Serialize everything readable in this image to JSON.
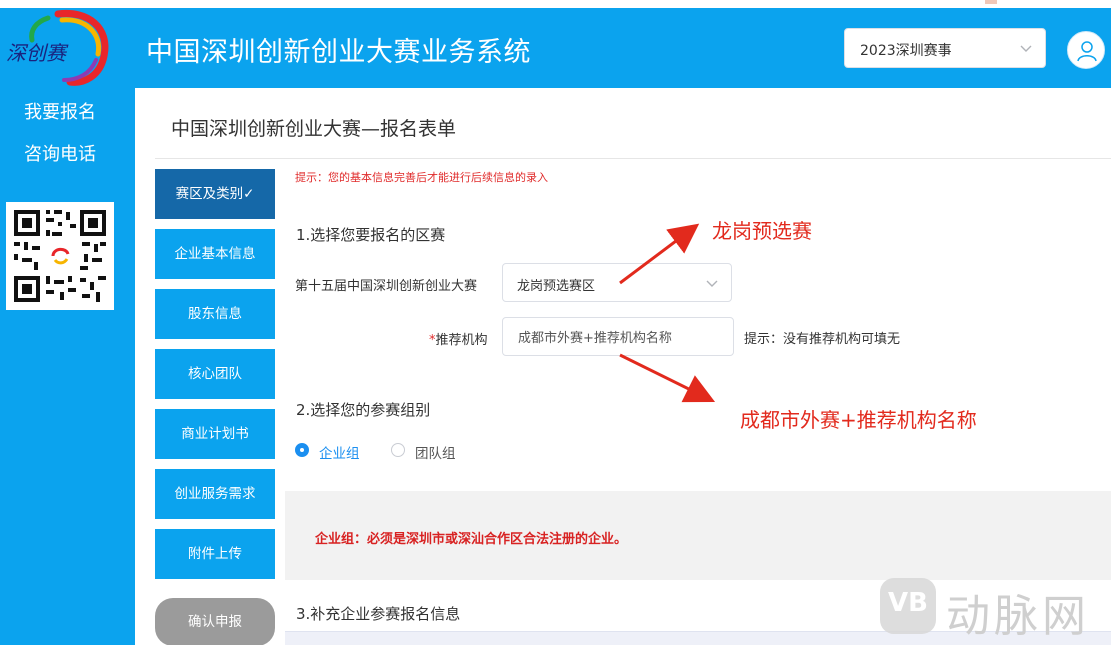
{
  "header": {
    "logo_text": "深创赛",
    "title": "中国深圳创新创业大赛业务系统",
    "year_select": "2023深圳赛事"
  },
  "left_nav": {
    "items": [
      {
        "label": "我要报名"
      },
      {
        "label": "咨询电话"
      }
    ]
  },
  "form": {
    "title": "中国深圳创新创业大赛—报名表单",
    "tip": "提示：您的基本信息完善后才能进行后续信息的录入",
    "steps": [
      {
        "label": "赛区及类别✓",
        "active": true
      },
      {
        "label": "企业基本信息"
      },
      {
        "label": "股东信息"
      },
      {
        "label": "核心团队"
      },
      {
        "label": "商业计划书"
      },
      {
        "label": "创业服务需求"
      },
      {
        "label": "附件上传"
      },
      {
        "label": "确认申报"
      }
    ],
    "section1_title": "1.选择您要报名的区赛",
    "competition_label": "第十五届中国深圳创新创业大赛",
    "region_value": "龙岗预选赛区",
    "recommender_label": "推荐机构",
    "recommender_required_mark": "*",
    "recommender_value": "成都市外赛+推荐机构名称",
    "recommender_hint": "提示：没有推荐机构可填无",
    "section2_title": "2.选择您的参赛组别",
    "groups": [
      {
        "label": "企业组",
        "checked": true
      },
      {
        "label": "团队组",
        "checked": false
      }
    ],
    "group_note": "企业组：必须是深圳市或深汕合作区合法注册的企业。",
    "section3_title": "3.补充企业参赛报名信息"
  },
  "annotations": {
    "top": "龙岗预选赛",
    "bottom": "成都市外赛+推荐机构名称"
  },
  "watermark": {
    "mark": "VB",
    "text": "动脉网"
  },
  "colors": {
    "brand_blue": "#0ba3ee",
    "active_step": "#1568a8",
    "annotation_red": "#e22a1d",
    "radio_blue": "#1b8ff0"
  }
}
